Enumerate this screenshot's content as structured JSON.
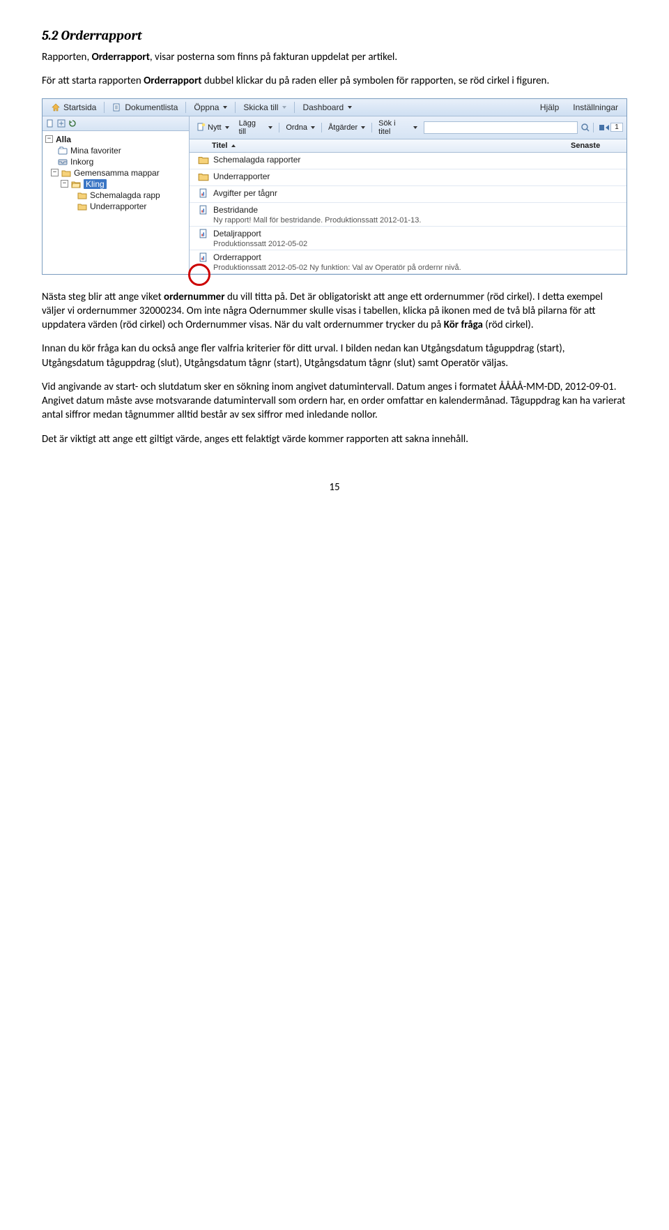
{
  "heading": "5.2 Orderrapport",
  "intro": "Rapporten, Orderrapport, visar posterna som finns på fakturan uppdelat per artikel.",
  "intro2": "För att starta rapporten Orderrapport dubbel klickar du på raden eller på symbolen för rapporten, se röd cirkel i figuren.",
  "toolbar": {
    "startsida": "Startsida",
    "dokumentlista": "Dokumentlista",
    "oppna": "Öppna",
    "skicka": "Skicka till",
    "dashboard": "Dashboard",
    "hjalp": "Hjälp",
    "installningar": "Inställningar"
  },
  "content_toolbar": {
    "nytt": "Nytt",
    "lagg_till": "Lägg till",
    "ordna": "Ordna",
    "atgarder": "Åtgärder",
    "sok": "Sök i titel",
    "page": "1"
  },
  "tree": {
    "alla": "Alla",
    "mina": "Mina favoriter",
    "inkorg": "Inkorg",
    "gemensamma": "Gemensamma mappar",
    "kling": "Kling",
    "schemalagda": "Schemalagda rapp",
    "underrapporter": "Underrapporter"
  },
  "list": {
    "header_title": "Titel",
    "header_senaste": "Senaste",
    "rows": [
      {
        "title": "Schemalagda rapporter",
        "subtitle": "",
        "icon": "folder"
      },
      {
        "title": "Underrapporter",
        "subtitle": "",
        "icon": "folder"
      },
      {
        "title": "Avgifter per tågnr",
        "subtitle": "",
        "icon": "report"
      },
      {
        "title": "Bestridande",
        "subtitle": "Ny rapport! Mall för bestridande. Produktionssatt 2012-01-13.",
        "icon": "report"
      },
      {
        "title": "Detaljrapport",
        "subtitle": "Produktionssatt 2012-05-02",
        "icon": "report"
      },
      {
        "title": "Orderrapport",
        "subtitle": "Produktionssatt 2012-05-02 Ny funktion: Val av Operatör på ordernr nivå.",
        "icon": "report"
      }
    ]
  },
  "para1": "Nästa steg blir att ange viket ordernummer du vill titta på. Det är obligatoriskt att ange ett ordernummer (röd cirkel). I detta exempel väljer vi ordernummer 32000234. Om inte några Odernummer skulle visas i tabellen, klicka på ikonen med de två blå pilarna för att uppdatera värden (röd cirkel) och Ordernummer visas. När du valt ordernummer trycker du på Kör fråga (röd cirkel).",
  "para2": "Innan du kör fråga kan du också ange fler valfria kriterier för ditt urval. I bilden nedan kan Utgångsdatum tåguppdrag (start), Utgångsdatum tåguppdrag (slut), Utgångsdatum tågnr (start), Utgångsdatum tågnr (slut) samt Operatör väljas.",
  "para3": "Vid angivande av start- och slutdatum sker en sökning inom angivet datumintervall. Datum anges i formatet ÅÅÅÅ-MM-DD,  2012-09-01. Angivet datum måste avse motsvarande datumintervall som ordern har, en order omfattar en kalendermånad. Tåguppdrag kan ha varierat antal siffror medan tågnummer alltid består av sex siffror med inledande nollor.",
  "para4": "Det är viktigt att ange ett giltigt värde, anges ett felaktigt värde kommer rapporten att sakna innehåll.",
  "page_number": "15"
}
